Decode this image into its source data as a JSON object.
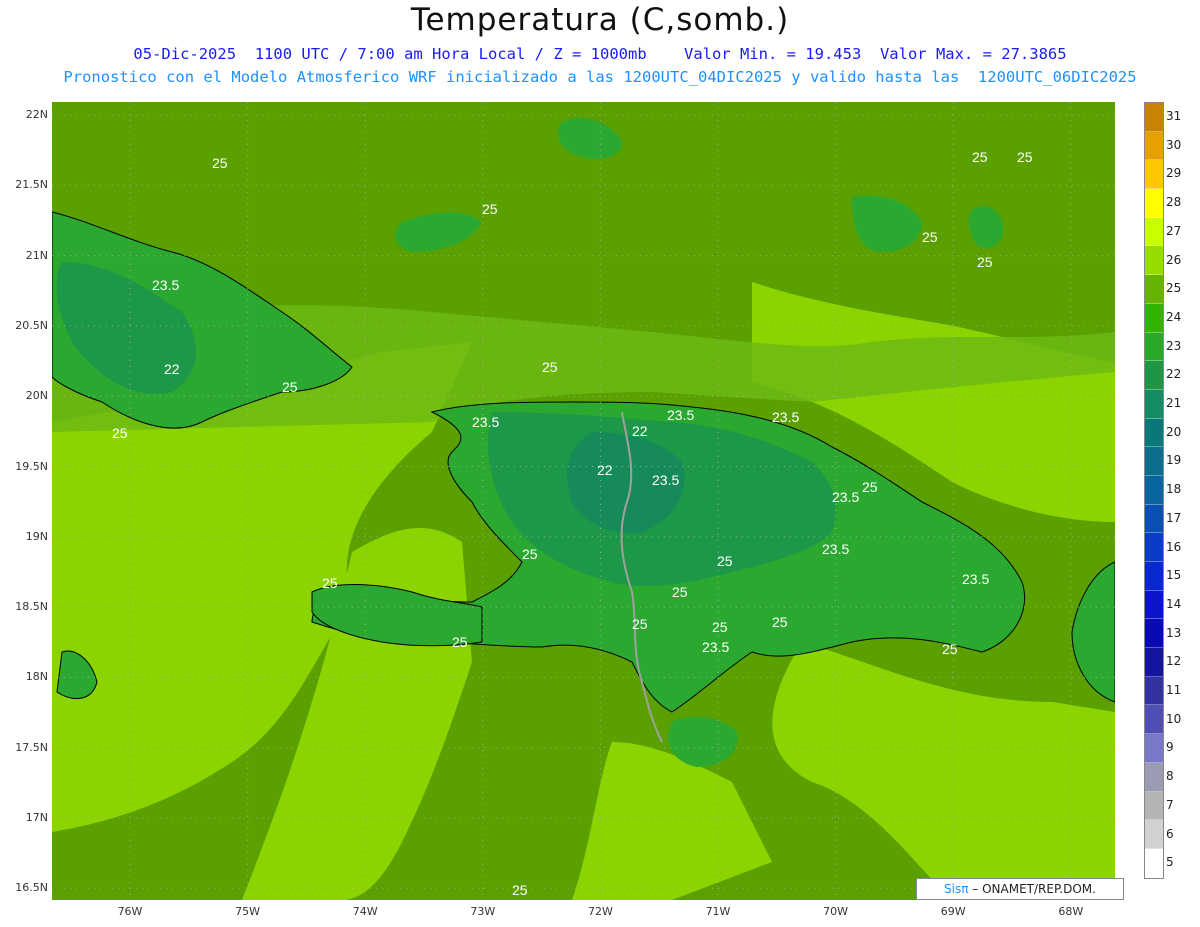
{
  "title": "Temperatura (C,somb.)",
  "subtitle1": "05-Dic-2025  1100 UTC / 7:00 am Hora Local / Z = 1000mb    Valor Min. = 19.453  Valor Max. = 27.3865",
  "subtitle2": "Pronostico con el Modelo Atmosferico WRF inicializado a las 1200UTC_04DIC2025 y valido hasta las  1200UTC_06DIC2025",
  "lat_labels": [
    "22N",
    "21.5N",
    "21N",
    "20.5N",
    "20N",
    "19.5N",
    "19N",
    "18.5N",
    "18N",
    "17.5N",
    "17N",
    "16.5N"
  ],
  "lon_labels": [
    "76W",
    "75W",
    "74W",
    "73W",
    "72W",
    "71W",
    "70W",
    "69W",
    "68W"
  ],
  "legend": {
    "values": [
      "31",
      "30",
      "29",
      "28",
      "27",
      "26",
      "25",
      "24",
      "23",
      "22",
      "21",
      "20",
      "19",
      "18",
      "17",
      "16",
      "15",
      "14",
      "13",
      "12",
      "11",
      "10",
      "9",
      "8",
      "7",
      "6",
      "5"
    ],
    "colors": [
      "#c88400",
      "#e6a000",
      "#ffc800",
      "#ffff00",
      "#c8ff00",
      "#96dc00",
      "#64b400",
      "#32b400",
      "#28aa28",
      "#1e9646",
      "#148c64",
      "#0a7878",
      "#0a6e8c",
      "#0a64a0",
      "#0a50b4",
      "#0a3cc8",
      "#0a28d2",
      "#0a14c8",
      "#0a0ab4",
      "#1414a0",
      "#3232a0",
      "#5050b4",
      "#7878c8",
      "#9b9bb4",
      "#b4b4b4",
      "#d2d2d2",
      "#ffffff"
    ]
  },
  "contour_labels": [
    "25",
    "25",
    "25",
    "25",
    "25",
    "25",
    "25",
    "25",
    "23.5",
    "23.5",
    "23.5",
    "23.5",
    "23.5",
    "23.5",
    "23.5",
    "23.5",
    "23.5",
    "22",
    "22",
    "22",
    "25",
    "25",
    "25",
    "25",
    "25",
    "25",
    "25",
    "25",
    "25",
    "25",
    "25",
    "25"
  ],
  "credit": {
    "sis": "Sisπ",
    "text": "– ONAMET/REP.DOM."
  },
  "colors": {
    "sea": "#5aa000",
    "warm": "#8cd400",
    "mid": "#6cba14",
    "land": "#2aa830",
    "cool": "#1c9848",
    "coast": "#000000",
    "border": "#a0a0a0"
  }
}
